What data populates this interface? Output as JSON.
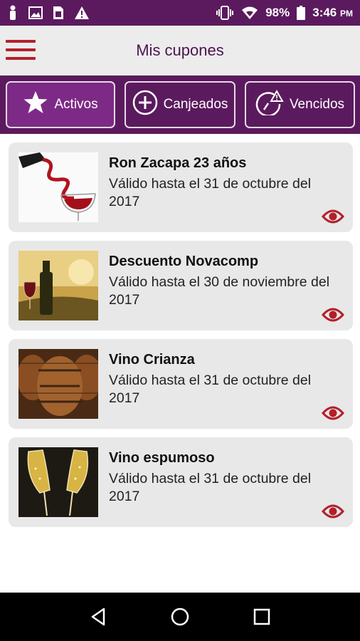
{
  "status": {
    "battery": "98%",
    "time": "3:46",
    "ampm": "PM"
  },
  "header": {
    "title": "Mis cupones",
    "menu_icon": "hamburger-menu-icon"
  },
  "tabs": [
    {
      "label": "Activos",
      "icon": "star-icon",
      "active": true
    },
    {
      "label": "Canjeados",
      "icon": "plus-circle-icon",
      "active": false
    },
    {
      "label": "Vencidos",
      "icon": "expired-clock-icon",
      "active": false
    }
  ],
  "coupons": [
    {
      "title": "Ron Zacapa 23 años",
      "desc": "Válido hasta el 31 de octubre del 2017",
      "image": "wine-pour-glass"
    },
    {
      "title": "Descuento Novacomp",
      "desc": "Válido hasta el 30 de noviembre del 2017",
      "image": "wine-bottle-vineyard"
    },
    {
      "title": "Vino Crianza",
      "desc": "Válido hasta el 31 de octubre del 2017",
      "image": "wine-barrels"
    },
    {
      "title": "Vino espumoso",
      "desc": "Válido hasta el 31 de octubre del 2017",
      "image": "champagne-flutes"
    }
  ],
  "colors": {
    "brand": "#5b1a5e",
    "accent": "#b3202a",
    "card": "#e8e8e8"
  }
}
